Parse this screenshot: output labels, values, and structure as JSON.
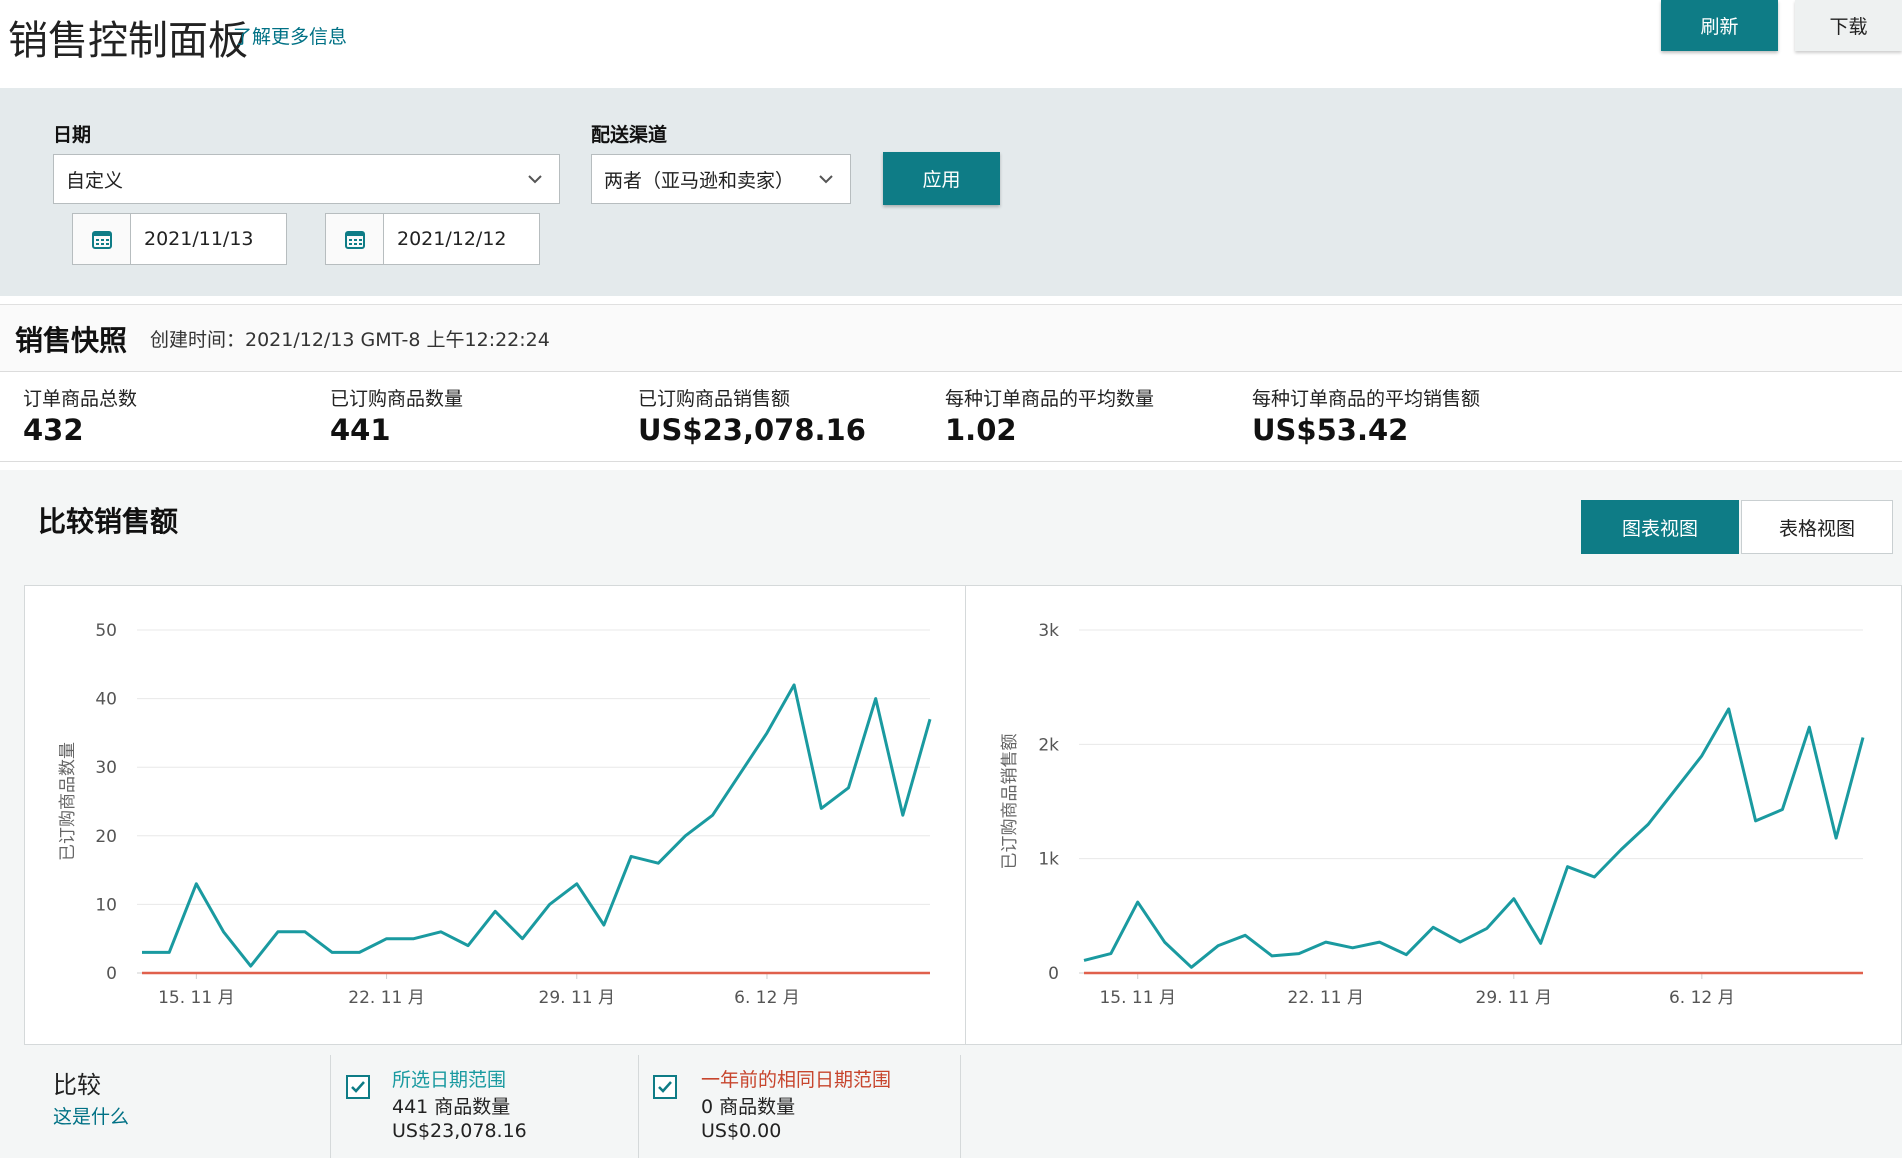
{
  "header": {
    "title": "销售控制面板",
    "learn_more": "了解更多信息",
    "refresh_label": "刷新",
    "download_label": "下载"
  },
  "filters": {
    "date_label": "日期",
    "date_value": "自定义",
    "start_date": "2021/11/13",
    "end_date": "2021/12/12",
    "channel_label": "配送渠道",
    "channel_value": "两者（亚马逊和卖家）",
    "apply_label": "应用"
  },
  "snapshot": {
    "title": "销售快照",
    "created": "创建时间：2021/12/13 GMT-8 上午12:22:24",
    "metrics": [
      {
        "label": "订单商品总数",
        "value": "432"
      },
      {
        "label": "已订购商品数量",
        "value": "441"
      },
      {
        "label": "已订购商品销售额",
        "value": "US$23,078.16"
      },
      {
        "label": "每种订单商品的平均数量",
        "value": "1.02"
      },
      {
        "label": "每种订单商品的平均销售额",
        "value": "US$53.42"
      }
    ]
  },
  "compare": {
    "title": "比较销售额",
    "view_chart": "图表视图",
    "view_table": "表格视图",
    "label": "比较",
    "what_is_this": "这是什么",
    "legend": [
      {
        "title": "所选日期范围",
        "units": "441 商品数量",
        "sales": "US$23,078.16",
        "color": "#1a9aa0"
      },
      {
        "title": "一年前的相同日期范围",
        "units": "0 商品数量",
        "sales": "US$0.00",
        "color": "#c7452d"
      }
    ]
  },
  "colors": {
    "accent": "#0e7c86",
    "series_current": "#1a9aa0",
    "series_last_year": "#e0604c"
  },
  "chart_data": [
    {
      "type": "line",
      "ylabel": "已订购商品数量",
      "xlabel": "",
      "x_ticks": [
        "15. 11 月",
        "22. 11 月",
        "29. 11 月",
        "6. 12 月"
      ],
      "y_ticks": [
        "0",
        "10",
        "20",
        "30",
        "40",
        "50"
      ],
      "ylim": [
        0,
        50
      ],
      "x": [
        "2021-11-13",
        "2021-11-14",
        "2021-11-15",
        "2021-11-16",
        "2021-11-17",
        "2021-11-18",
        "2021-11-19",
        "2021-11-20",
        "2021-11-21",
        "2021-11-22",
        "2021-11-23",
        "2021-11-24",
        "2021-11-25",
        "2021-11-26",
        "2021-11-27",
        "2021-11-28",
        "2021-11-29",
        "2021-11-30",
        "2021-12-01",
        "2021-12-02",
        "2021-12-03",
        "2021-12-04",
        "2021-12-05",
        "2021-12-06",
        "2021-12-07",
        "2021-12-08",
        "2021-12-09",
        "2021-12-10",
        "2021-12-11",
        "2021-12-12"
      ],
      "series": [
        {
          "values": [
            3,
            3,
            13,
            6,
            1,
            6,
            6,
            3,
            3,
            5,
            5,
            6,
            4,
            9,
            5,
            10,
            13,
            7,
            17,
            16,
            20,
            23,
            29,
            35,
            42,
            24,
            27,
            40,
            23,
            37
          ]
        },
        {
          "values": [
            0,
            0,
            0,
            0,
            0,
            0,
            0,
            0,
            0,
            0,
            0,
            0,
            0,
            0,
            0,
            0,
            0,
            0,
            0,
            0,
            0,
            0,
            0,
            0,
            0,
            0,
            0,
            0,
            0,
            0
          ]
        }
      ]
    },
    {
      "type": "line",
      "ylabel": "已订购商品销售额",
      "xlabel": "",
      "x_ticks": [
        "15. 11 月",
        "22. 11 月",
        "29. 11 月",
        "6. 12 月"
      ],
      "y_ticks": [
        "0",
        "1k",
        "2k",
        "3k"
      ],
      "ylim": [
        0,
        3000
      ],
      "x": [
        "2021-11-13",
        "2021-11-14",
        "2021-11-15",
        "2021-11-16",
        "2021-11-17",
        "2021-11-18",
        "2021-11-19",
        "2021-11-20",
        "2021-11-21",
        "2021-11-22",
        "2021-11-23",
        "2021-11-24",
        "2021-11-25",
        "2021-11-26",
        "2021-11-27",
        "2021-11-28",
        "2021-11-29",
        "2021-11-30",
        "2021-12-01",
        "2021-12-02",
        "2021-12-03",
        "2021-12-04",
        "2021-12-05",
        "2021-12-06",
        "2021-12-07",
        "2021-12-08",
        "2021-12-09",
        "2021-12-10",
        "2021-12-11",
        "2021-12-12"
      ],
      "series": [
        {
          "values": [
            110,
            170,
            620,
            270,
            50,
            240,
            330,
            150,
            170,
            270,
            220,
            270,
            160,
            400,
            270,
            390,
            650,
            260,
            930,
            840,
            1080,
            1300,
            1600,
            1900,
            2310,
            1330,
            1430,
            2150,
            1180,
            2060
          ]
        },
        {
          "values": [
            0,
            0,
            0,
            0,
            0,
            0,
            0,
            0,
            0,
            0,
            0,
            0,
            0,
            0,
            0,
            0,
            0,
            0,
            0,
            0,
            0,
            0,
            0,
            0,
            0,
            0,
            0,
            0,
            0,
            0
          ]
        }
      ]
    }
  ]
}
